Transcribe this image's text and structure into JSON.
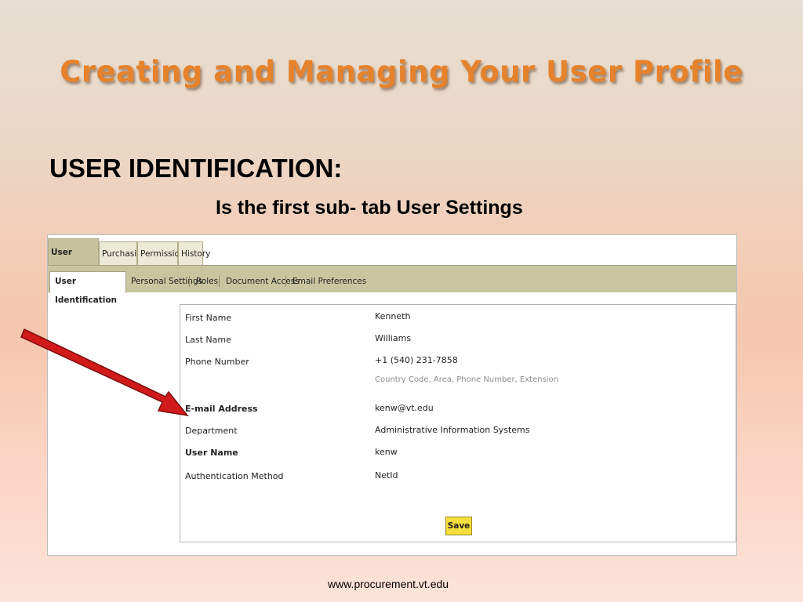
{
  "slide": {
    "title": "Creating and Managing Your User Profile",
    "heading": "USER IDENTIFICATION:",
    "subheading": "Is the first sub- tab User Settings",
    "footer": "www.procurement.vt.edu"
  },
  "tabs": [
    "User Settings",
    "Purchasing",
    "Permissions",
    "History"
  ],
  "subtabs": [
    "User Identification",
    "Personal Settings",
    "Roles",
    "Document Access",
    "Email Preferences"
  ],
  "form": {
    "first_name_label": "First Name",
    "first_name": "Kenneth",
    "last_name_label": "Last Name",
    "last_name": "Williams",
    "phone_label": "Phone Number",
    "phone": "+1 (540) 231-7858",
    "phone_hint": "Country Code, Area, Phone Number, Extension",
    "email_label": "E-mail Address",
    "email": "kenw@vt.edu",
    "department_label": "Department",
    "department": "Administrative Information Systems",
    "username_label": "User Name",
    "username": "kenw",
    "auth_label": "Authentication Method",
    "auth": "NetId",
    "save_label": "Save"
  },
  "colors": {
    "title": "#e5822b",
    "tab_bar": "#c9c5a0",
    "arrow": "#d11a1a",
    "save_button": "#f5de3d"
  }
}
